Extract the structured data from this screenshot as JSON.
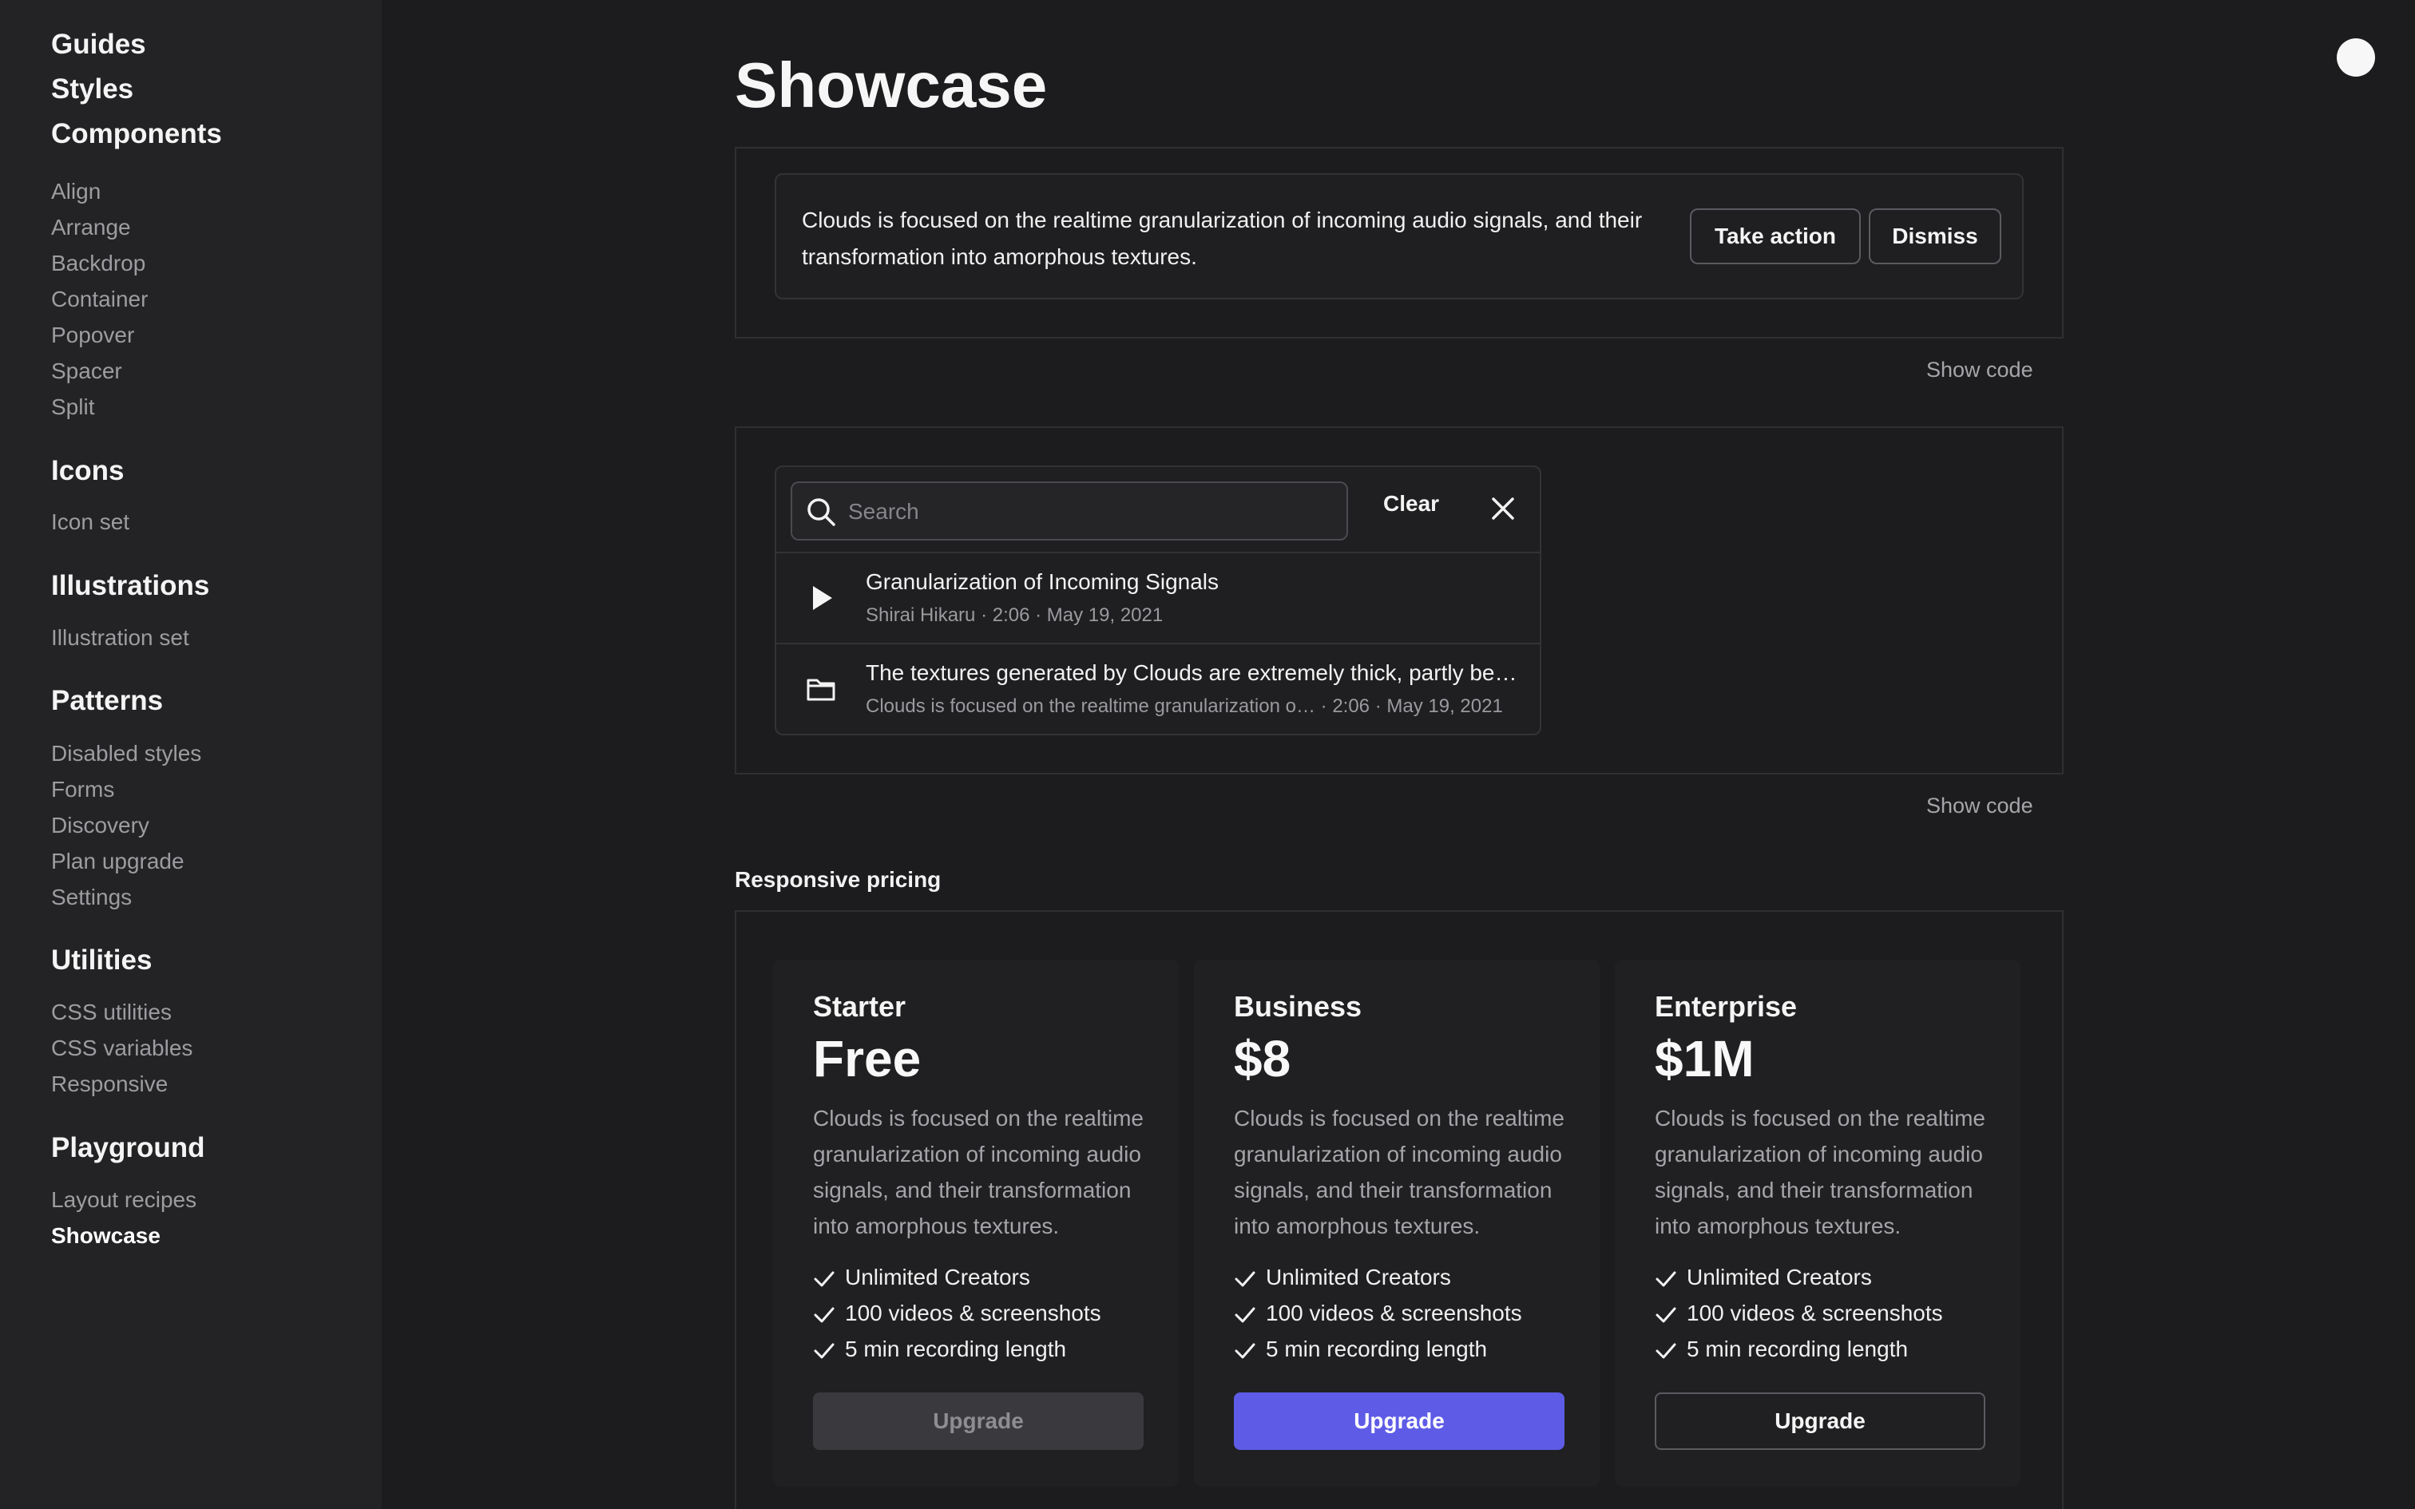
{
  "sidebar": {
    "sections": [
      {
        "title": "Guides"
      },
      {
        "title": "Styles"
      },
      {
        "title": "Components",
        "items": [
          "Align",
          "Arrange",
          "Backdrop",
          "Container",
          "Popover",
          "Spacer",
          "Split"
        ]
      },
      {
        "title": "Icons",
        "items": [
          "Icon set"
        ]
      },
      {
        "title": "Illustrations",
        "items": [
          "Illustration set"
        ]
      },
      {
        "title": "Patterns",
        "items": [
          "Disabled styles",
          "Forms",
          "Discovery",
          "Plan upgrade",
          "Settings"
        ]
      },
      {
        "title": "Utilities",
        "items": [
          "CSS utilities",
          "CSS variables",
          "Responsive"
        ]
      },
      {
        "title": "Playground",
        "items": [
          "Layout recipes",
          "Showcase"
        ]
      }
    ],
    "active_item": "Showcase"
  },
  "page": {
    "title": "Showcase"
  },
  "banner": {
    "text": "Clouds is focused on the realtime granularization of incoming audio signals, and their transformation into amorphous textures.",
    "primary_label": "Take action",
    "secondary_label": "Dismiss",
    "show_code": "Show code"
  },
  "search": {
    "placeholder": "Search",
    "clear_label": "Clear",
    "show_code": "Show code",
    "results": [
      {
        "icon": "play-icon",
        "title": "Granularization of Incoming Signals",
        "meta_lead": "Shirai Hikaru",
        "duration": "2:06",
        "date": "May 19, 2021"
      },
      {
        "icon": "folder-icon",
        "title": "The textures generated by Clouds are extremely thick, partly be…",
        "meta_lead": "Clouds is focused on the realtime granularization o…",
        "duration": "2:06",
        "date": "May 19, 2021"
      }
    ]
  },
  "pricing": {
    "section_label": "Responsive pricing",
    "plans": [
      {
        "name": "Starter",
        "price": "Free",
        "description": "Clouds is focused on the realtime granularization of incoming audio signals, and their transformation into amorphous textures.",
        "features": [
          "Unlimited Creators",
          "100 videos & screenshots",
          "5 min recording length"
        ],
        "button_label": "Upgrade",
        "button_state": "disabled"
      },
      {
        "name": "Business",
        "price": "$8",
        "description": "Clouds is focused on the realtime granularization of incoming audio signals, and their transformation into amorphous textures.",
        "features": [
          "Unlimited Creators",
          "100 videos & screenshots",
          "5 min recording length"
        ],
        "button_label": "Upgrade",
        "button_state": "primary"
      },
      {
        "name": "Enterprise",
        "price": "$1M",
        "description": "Clouds is focused on the realtime granularization of incoming audio signals, and their transformation into amorphous textures.",
        "features": [
          "Unlimited Creators",
          "100 videos & screenshots",
          "5 min recording length"
        ],
        "button_label": "Upgrade",
        "button_state": "outline"
      }
    ]
  },
  "colors": {
    "background": "#1c1c1e",
    "sidebar": "#232325",
    "accent": "#5e5ce6",
    "muted_text": "#9d9da1"
  }
}
